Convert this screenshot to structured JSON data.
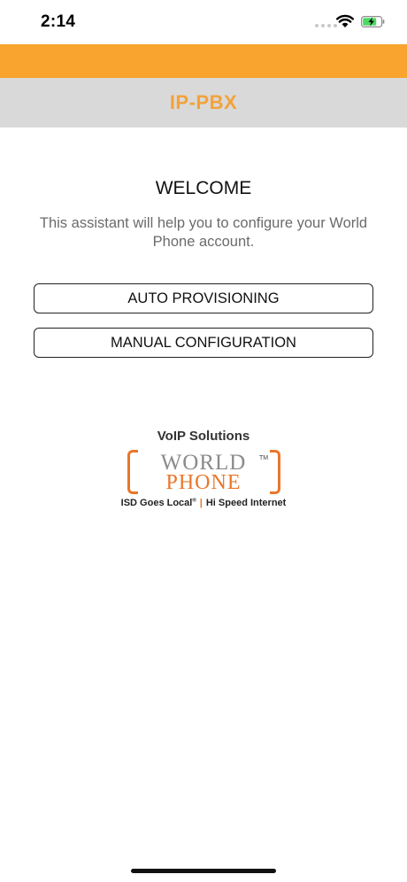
{
  "status_bar": {
    "time": "2:14",
    "icons": [
      "signal-dots-icon",
      "wifi-icon",
      "battery-charging-icon"
    ],
    "battery_color": "#4cd964"
  },
  "header": {
    "title": "IP-PBX",
    "accent_color": "#f8a42e",
    "title_bar_color": "#d9d9d9"
  },
  "content": {
    "heading": "WELCOME",
    "description": "This assistant will help you to configure your World Phone account."
  },
  "buttons": {
    "auto_provisioning": "AUTO PROVISIONING",
    "manual_configuration": "MANUAL CONFIGURATION"
  },
  "logo": {
    "subtitle": "VoIP Solutions",
    "word_top": "WORLD",
    "trademark": "TM",
    "word_bottom": "PHONE",
    "tagline_left": "ISD Goes Local",
    "tagline_left_mark": "®",
    "tagline_right": "Hi Speed Internet"
  }
}
